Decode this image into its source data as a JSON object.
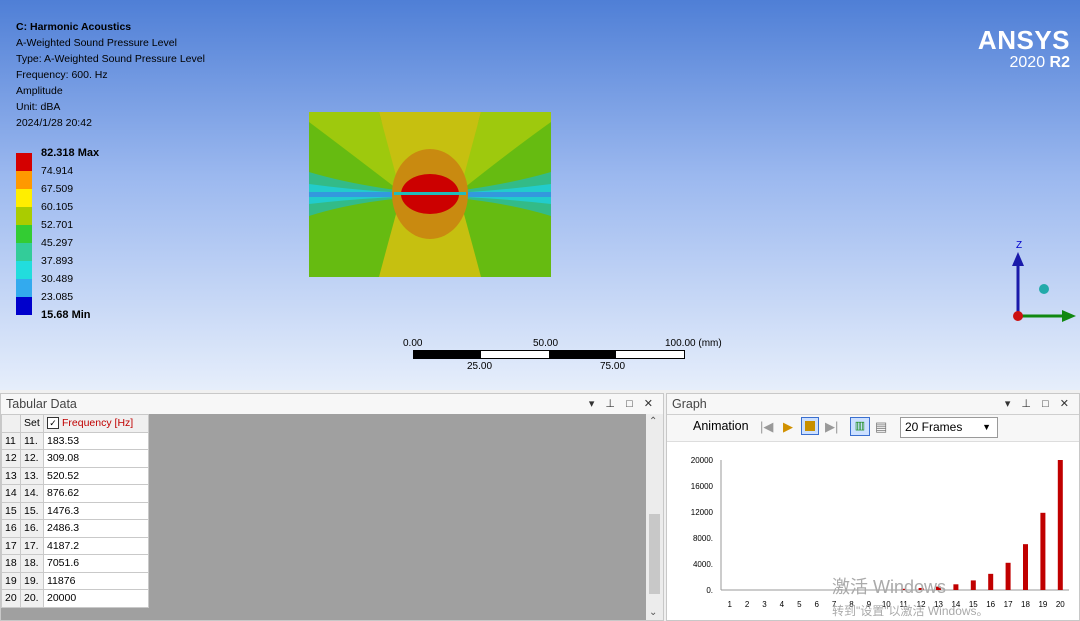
{
  "viewport": {
    "title": "C: Harmonic Acoustics",
    "lines": [
      "A-Weighted Sound Pressure Level",
      "Type: A-Weighted Sound Pressure Level",
      "Frequency: 600. Hz",
      "Amplitude",
      "Unit: dBA",
      "2024/1/28 20:42"
    ],
    "legend": {
      "max": "82.318 Max",
      "min": "15.68 Min",
      "ticks": [
        "74.914",
        "67.509",
        "60.105",
        "52.701",
        "45.297",
        "37.893",
        "30.489",
        "23.085"
      ],
      "colors": [
        "#d40000",
        "#ff9900",
        "#ffee00",
        "#aacc00",
        "#33cc33",
        "#33cc99",
        "#22dddd",
        "#33aaee",
        "#0000cc"
      ]
    },
    "logo": {
      "brand": "ANSYS",
      "version_num": "2020",
      "version_rel": "R2"
    },
    "scale_bar": {
      "labels_top": [
        "0.00",
        "50.00",
        "100.00 (mm)"
      ],
      "labels_bottom": [
        "25.00",
        "75.00"
      ]
    },
    "triad": {
      "axis": "Z"
    }
  },
  "tabular": {
    "title": "Tabular Data",
    "controls": "▾ ⊥ □ ✕",
    "col_set": "Set",
    "col_freq": "Frequency [Hz]",
    "rows": [
      {
        "idx": "11",
        "set": "11.",
        "freq": "183.53"
      },
      {
        "idx": "12",
        "set": "12.",
        "freq": "309.08"
      },
      {
        "idx": "13",
        "set": "13.",
        "freq": "520.52"
      },
      {
        "idx": "14",
        "set": "14.",
        "freq": "876.62"
      },
      {
        "idx": "15",
        "set": "15.",
        "freq": "1476.3"
      },
      {
        "idx": "16",
        "set": "16.",
        "freq": "2486.3"
      },
      {
        "idx": "17",
        "set": "17.",
        "freq": "4187.2"
      },
      {
        "idx": "18",
        "set": "18.",
        "freq": "7051.6"
      },
      {
        "idx": "19",
        "set": "19.",
        "freq": "11876"
      },
      {
        "idx": "20",
        "set": "20.",
        "freq": "20000"
      }
    ]
  },
  "graph": {
    "title": "Graph",
    "controls": "▾ ⊥ □ ✕",
    "animation_label": "Animation",
    "frames": "20 Frames"
  },
  "chart_data": {
    "type": "bar",
    "categories": [
      "1",
      "2",
      "3",
      "4",
      "5",
      "6",
      "7",
      "8",
      "9",
      "10",
      "11",
      "12",
      "13",
      "14",
      "15",
      "16",
      "17",
      "18",
      "19",
      "20"
    ],
    "values": [
      0,
      0,
      0,
      0,
      0,
      0,
      0,
      0,
      0,
      0,
      183.53,
      309.08,
      520.52,
      876.62,
      1476.3,
      2486.3,
      4187.2,
      7051.6,
      11876,
      20000
    ],
    "ytick_labels": [
      "0.",
      "4000.",
      "8000.",
      "12000",
      "16000",
      "20000"
    ],
    "ylim": [
      0,
      20000
    ],
    "bar_color": "#c00000"
  },
  "watermark": {
    "line1": "激活 Windows",
    "line2": "转到\"设置\"以激活 Windows。"
  }
}
